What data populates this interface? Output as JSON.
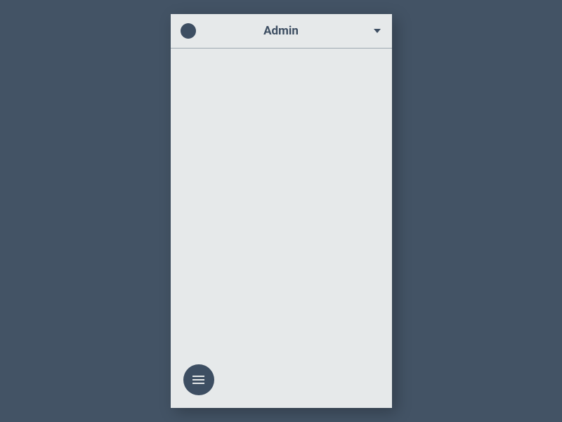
{
  "header": {
    "title": "Admin"
  }
}
